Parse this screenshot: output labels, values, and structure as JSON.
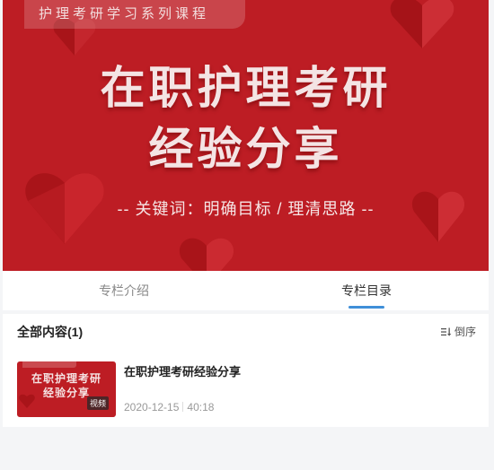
{
  "banner": {
    "series_tag": "护理考研学习系列课程",
    "title_line1": "在职护理考研",
    "title_line2": "经验分享",
    "keywords": "-- 关键词：明确目标 / 理清思路 --"
  },
  "tabs": [
    {
      "label": "专栏介绍",
      "active": false
    },
    {
      "label": "专栏目录",
      "active": true
    }
  ],
  "section": {
    "title": "全部内容(1)",
    "sort_label": "倒序"
  },
  "items": [
    {
      "title": "在职护理考研经验分享",
      "thumb_line1": "在职护理考研",
      "thumb_line2": "经验分享",
      "badge": "视频",
      "date": "2020-12-15",
      "duration": "40:18"
    }
  ],
  "colors": {
    "banner_red": "#bd1d24",
    "accent_blue": "#3f8fd8"
  },
  "icons": {
    "sort": "sort-icon",
    "heart": "heart-icon"
  }
}
